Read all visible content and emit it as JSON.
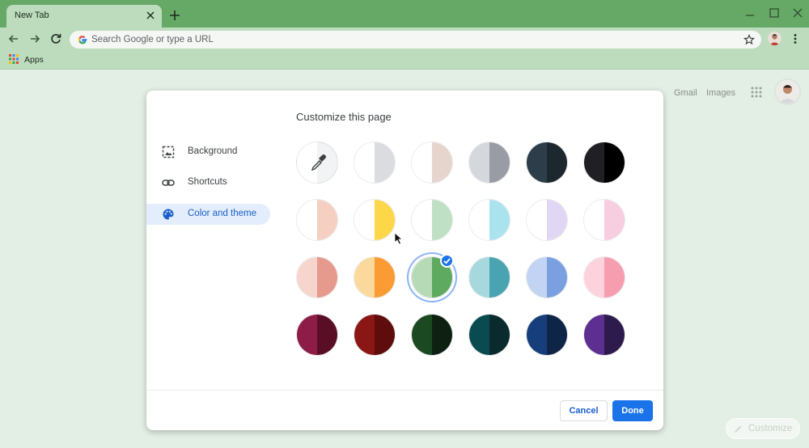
{
  "browser": {
    "tab_title": "New Tab",
    "omnibox_placeholder": "Search Google or type a URL",
    "bookmarks": {
      "apps_label": "Apps"
    }
  },
  "ntp": {
    "gmail_link": "Gmail",
    "images_link": "Images",
    "customize_label": "Customize"
  },
  "dialog": {
    "title": "Customize this page",
    "menu": [
      {
        "label": "Background",
        "icon": "background-icon"
      },
      {
        "label": "Shortcuts",
        "icon": "link-icon"
      },
      {
        "label": "Color and theme",
        "icon": "palette-icon",
        "active": true
      }
    ],
    "themes": [
      {
        "name": "custom-color",
        "left": "#f1f3f4",
        "right": "#f1f3f4",
        "custom": true
      },
      {
        "name": "default-light",
        "left": "#ffffff",
        "right": "#dadce0"
      },
      {
        "name": "warm-grey",
        "left": "#ffffff",
        "right": "#e6d5cd"
      },
      {
        "name": "cool-grey",
        "left": "#d4d7dc",
        "right": "#999ca5"
      },
      {
        "name": "midnight-blue",
        "left": "#2d3e4a",
        "right": "#1c272e"
      },
      {
        "name": "black",
        "left": "#202024",
        "right": "#000000"
      },
      {
        "name": "beige-white",
        "left": "#ffffff",
        "right": "#f5cfc1"
      },
      {
        "name": "yellow-white",
        "left": "#ffffff",
        "right": "#fdd64a"
      },
      {
        "name": "green-white",
        "left": "#ffffff",
        "right": "#bfe0c5"
      },
      {
        "name": "light-teal-white",
        "left": "#ffffff",
        "right": "#aae3ee"
      },
      {
        "name": "light-purple-white",
        "left": "#ffffff",
        "right": "#e2d6f5"
      },
      {
        "name": "pink-white",
        "left": "#ffffff",
        "right": "#f6cee0"
      },
      {
        "name": "beige",
        "left": "#f6d6cc",
        "right": "#e6998d"
      },
      {
        "name": "orange",
        "left": "#fbd89b",
        "right": "#fb9b33"
      },
      {
        "name": "light-green",
        "left": "#b6dab6",
        "right": "#5eaa60",
        "selected": true
      },
      {
        "name": "light-teal",
        "left": "#a7d8de",
        "right": "#4aa3b0"
      },
      {
        "name": "light-purple",
        "left": "#c2d3f3",
        "right": "#7ba0e0"
      },
      {
        "name": "pink",
        "left": "#fcd3dc",
        "right": "#f69db0"
      },
      {
        "name": "dark-red-pink",
        "left": "#8d1d46",
        "right": "#5a0e26"
      },
      {
        "name": "dark-red",
        "left": "#8b1616",
        "right": "#5e0c0c"
      },
      {
        "name": "dark-green",
        "left": "#1b4a22",
        "right": "#0d2012"
      },
      {
        "name": "dark-teal",
        "left": "#0a4b52",
        "right": "#0a2a2e"
      },
      {
        "name": "dark-blue",
        "left": "#163e7c",
        "right": "#0e2548"
      },
      {
        "name": "purple",
        "left": "#5c2f90",
        "right": "#2e1b4d"
      }
    ],
    "cancel_label": "Cancel",
    "done_label": "Done"
  },
  "colors": {
    "frame": "#66a866",
    "toolbar": "#bcdcbd",
    "accent": "#1a73e8"
  }
}
